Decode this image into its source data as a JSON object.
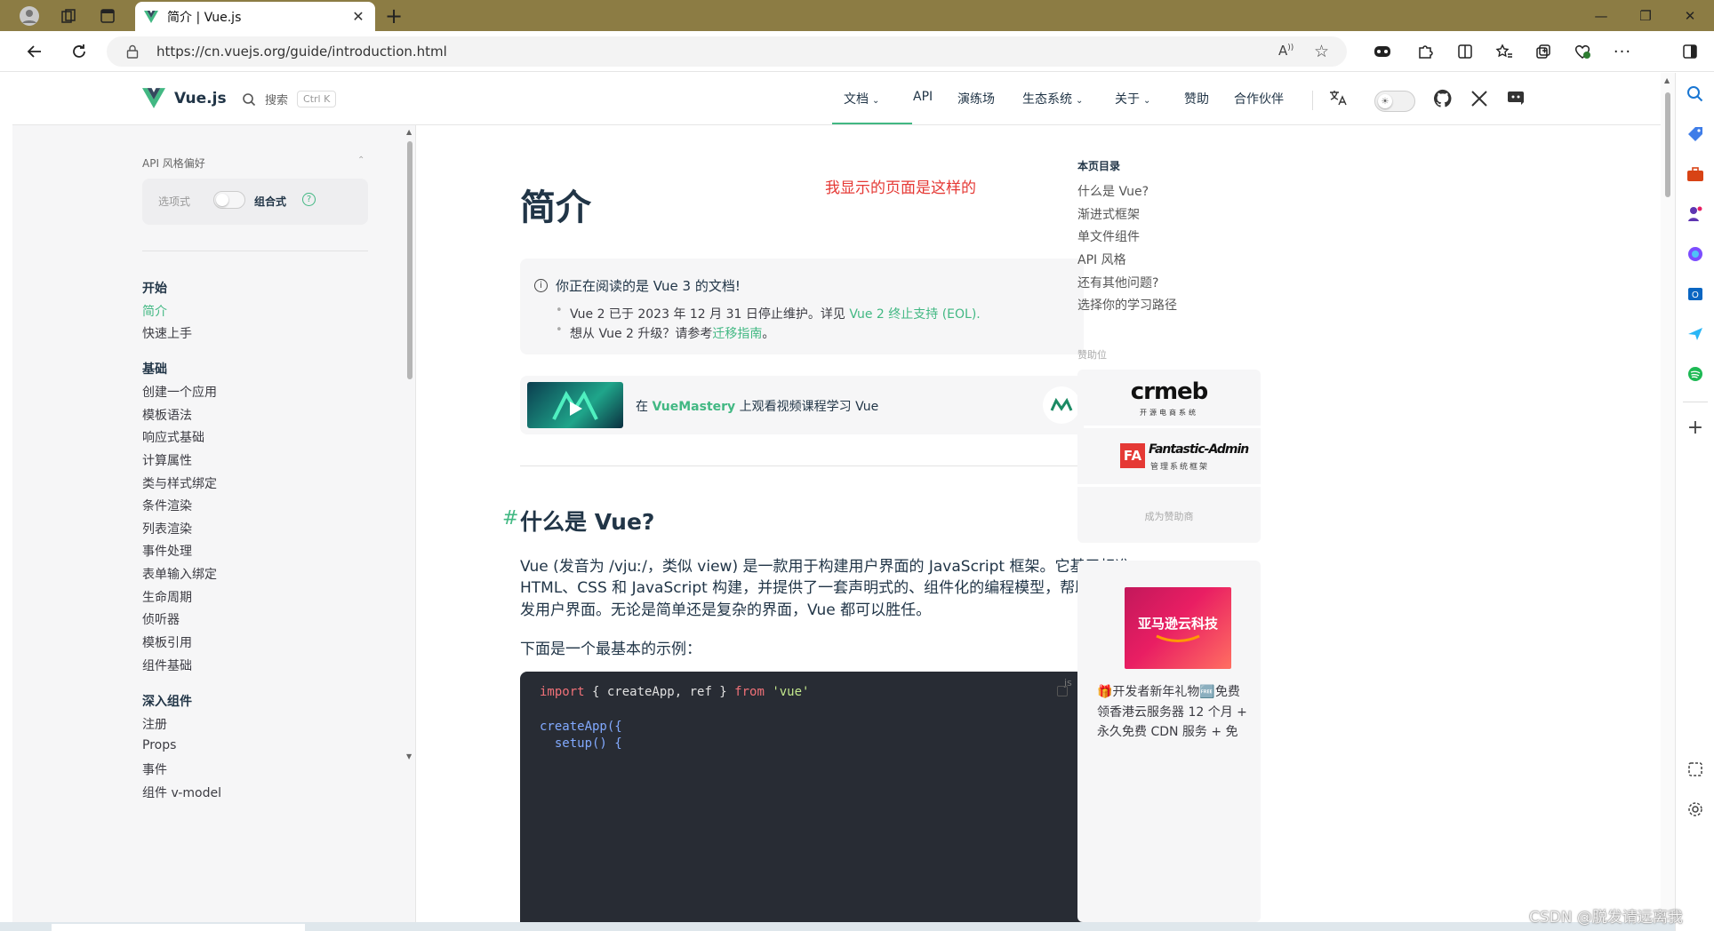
{
  "browser": {
    "tab_title": "简介 | Vue.js",
    "url": "https://cn.vuejs.org/guide/introduction.html"
  },
  "navbar": {
    "brand": "Vue.js",
    "search_label": "搜索",
    "search_shortcut": "Ctrl K",
    "links": [
      "文档",
      "API",
      "演练场",
      "生态系统",
      "关于",
      "赞助",
      "合作伙伴"
    ]
  },
  "sidebar": {
    "api_pref_title": "API 风格偏好",
    "toggle_left": "选项式",
    "toggle_right": "组合式",
    "sections": [
      {
        "title": "开始",
        "items": [
          "简介",
          "快速上手"
        ]
      },
      {
        "title": "基础",
        "items": [
          "创建一个应用",
          "模板语法",
          "响应式基础",
          "计算属性",
          "类与样式绑定",
          "条件渲染",
          "列表渲染",
          "事件处理",
          "表单输入绑定",
          "生命周期",
          "侦听器",
          "模板引用",
          "组件基础"
        ]
      },
      {
        "title": "深入组件",
        "items": [
          "注册",
          "Props",
          "事件",
          "组件 v-model"
        ]
      }
    ]
  },
  "main": {
    "title": "简介",
    "annotation": "我显示的页面是这样的",
    "notice": {
      "title": "你正在阅读的是 Vue 3 的文档!",
      "line1_prefix": "Vue 2 已于 2023 年 12 月 31 日停止维护。详见 ",
      "line1_link": "Vue 2 终止支持 (EOL).",
      "line2_prefix": "想从 Vue 2 升级？请参考",
      "line2_link": "迁移指南",
      "line2_suffix": "。"
    },
    "mastery": {
      "prefix": "在 ",
      "link": "VueMastery",
      "suffix": " 上观看视频课程学习 Vue"
    },
    "section_hash": "#",
    "section_title": "什么是 Vue?",
    "para_line1": "Vue (发音为 /vjuː/，类似 view) 是一款用于构建用户界面的 JavaScript 框架。它基于标准",
    "para_line2": "HTML、CSS 和 JavaScript 构建，并提供了一套声明式的、组件化的编程模型，帮助你高效地开",
    "para_line3": "发用户界面。无论是简单还是复杂的界面，Vue 都可以胜任。",
    "example_intro": "下面是一个最基本的示例：",
    "code": {
      "lang": "js",
      "line1_kw": "import",
      "line1_mid": " { createApp, ref } ",
      "line1_from": "from",
      "line1_str": "'vue'",
      "line2": "createApp({",
      "line3": "  setup() {"
    }
  },
  "toc": {
    "title": "本页目录",
    "items": [
      "什么是 Vue?",
      "渐进式框架",
      "单文件组件",
      "API 风格",
      "还有其他问题?",
      "选择你的学习路径"
    ],
    "sponsor_label": "赞助位",
    "sponsor1_logo": "crmeb",
    "sponsor1_sub": "开源电商系统",
    "sponsor2_logo": "Fantastic-Admin",
    "sponsor2_sub": "管理系统框架",
    "become_sponsor": "成为赞助商",
    "ad_image_text": "亚马逊云科技",
    "ad_line1": "🎁开发者新年礼物🆓免费",
    "ad_line2": "领香港云服务器 12 个月 +",
    "ad_line3": "永久免费 CDN 服务 + 免"
  },
  "watermark": "CSDN @脱发请远离我",
  "colors": {
    "accent": "#42b883",
    "tabstrip": "#8c7c44",
    "annotation": "#e53935",
    "code_bg": "#282c34"
  }
}
